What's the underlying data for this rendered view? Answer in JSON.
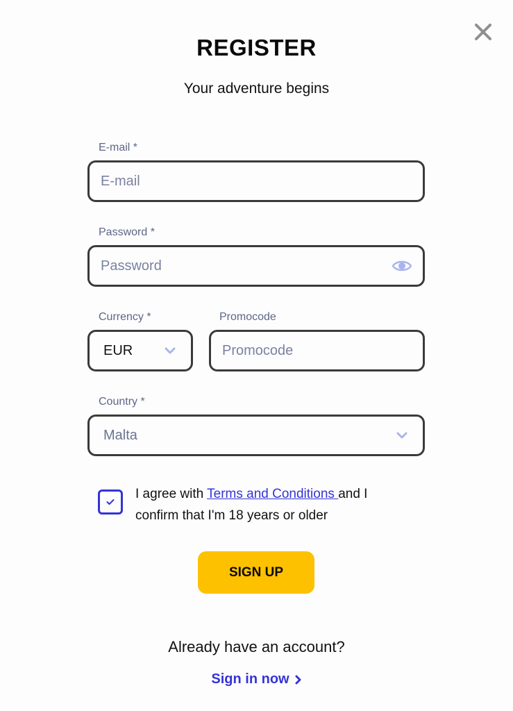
{
  "header": {
    "title": "REGISTER",
    "subtitle": "Your adventure begins",
    "close_icon": "close-x-icon"
  },
  "form": {
    "email": {
      "label": "E-mail *",
      "placeholder": "E-mail",
      "value": ""
    },
    "password": {
      "label": "Password *",
      "placeholder": "Password",
      "value": "",
      "toggle_icon": "eye-icon"
    },
    "currency": {
      "label": "Currency *",
      "value": "EUR",
      "icon": "chevron-down-icon"
    },
    "promocode": {
      "label": "Promocode",
      "placeholder": "Promocode",
      "value": ""
    },
    "country": {
      "label": "Country *",
      "value": "Malta",
      "icon": "chevron-down-icon"
    },
    "agreement": {
      "checked": true,
      "text_before": "I agree with ",
      "link_text": "Terms and Conditions ",
      "text_after": "and I confirm that I'm 18 years or older"
    },
    "submit_label": "SIGN UP"
  },
  "footer": {
    "already_text": "Already have an account?",
    "signin_label": "Sign in now",
    "signin_icon": "chevron-right-icon"
  },
  "colors": {
    "accent": "#3434d6",
    "button": "#fdc100",
    "label": "#5d6685",
    "placeholder": "#7a81a0",
    "icon_light": "#a9b4ee",
    "close": "#8f8f8f"
  }
}
